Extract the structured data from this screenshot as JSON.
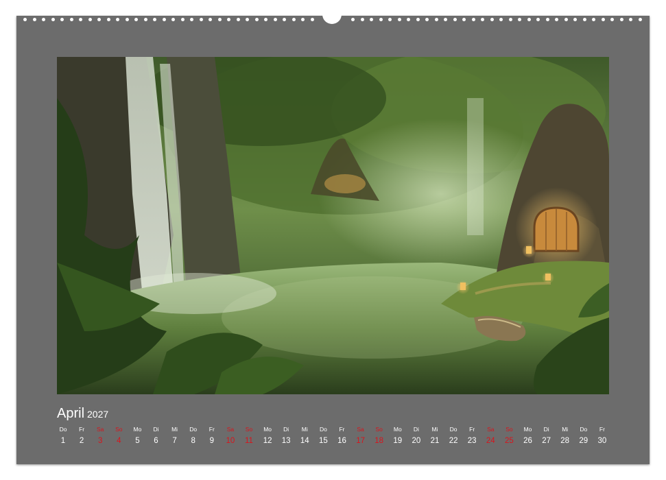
{
  "calendar": {
    "month": "April",
    "year": "2027",
    "weekend_color": "#d8141c",
    "text_color": "#ffffff",
    "frame_color": "#6c6c6c",
    "days": [
      {
        "wd": "Do",
        "d": "1",
        "we": false
      },
      {
        "wd": "Fr",
        "d": "2",
        "we": false
      },
      {
        "wd": "Sa",
        "d": "3",
        "we": true
      },
      {
        "wd": "So",
        "d": "4",
        "we": true
      },
      {
        "wd": "Mo",
        "d": "5",
        "we": false
      },
      {
        "wd": "Di",
        "d": "6",
        "we": false
      },
      {
        "wd": "Mi",
        "d": "7",
        "we": false
      },
      {
        "wd": "Do",
        "d": "8",
        "we": false
      },
      {
        "wd": "Fr",
        "d": "9",
        "we": false
      },
      {
        "wd": "Sa",
        "d": "10",
        "we": true
      },
      {
        "wd": "So",
        "d": "11",
        "we": true
      },
      {
        "wd": "Mo",
        "d": "12",
        "we": false
      },
      {
        "wd": "Di",
        "d": "13",
        "we": false
      },
      {
        "wd": "Mi",
        "d": "14",
        "we": false
      },
      {
        "wd": "Do",
        "d": "15",
        "we": false
      },
      {
        "wd": "Fr",
        "d": "16",
        "we": false
      },
      {
        "wd": "Sa",
        "d": "17",
        "we": true
      },
      {
        "wd": "So",
        "d": "18",
        "we": true
      },
      {
        "wd": "Mo",
        "d": "19",
        "we": false
      },
      {
        "wd": "Di",
        "d": "20",
        "we": false
      },
      {
        "wd": "Mi",
        "d": "21",
        "we": false
      },
      {
        "wd": "Do",
        "d": "22",
        "we": false
      },
      {
        "wd": "Fr",
        "d": "23",
        "we": false
      },
      {
        "wd": "Sa",
        "d": "24",
        "we": true
      },
      {
        "wd": "So",
        "d": "25",
        "we": true
      },
      {
        "wd": "Mo",
        "d": "26",
        "we": false
      },
      {
        "wd": "Di",
        "d": "27",
        "we": false
      },
      {
        "wd": "Mi",
        "d": "28",
        "we": false
      },
      {
        "wd": "Do",
        "d": "29",
        "we": false
      },
      {
        "wd": "Fr",
        "d": "30",
        "we": false
      }
    ]
  },
  "photo": {
    "subject": "forest-pond-fairy-house-icon"
  }
}
